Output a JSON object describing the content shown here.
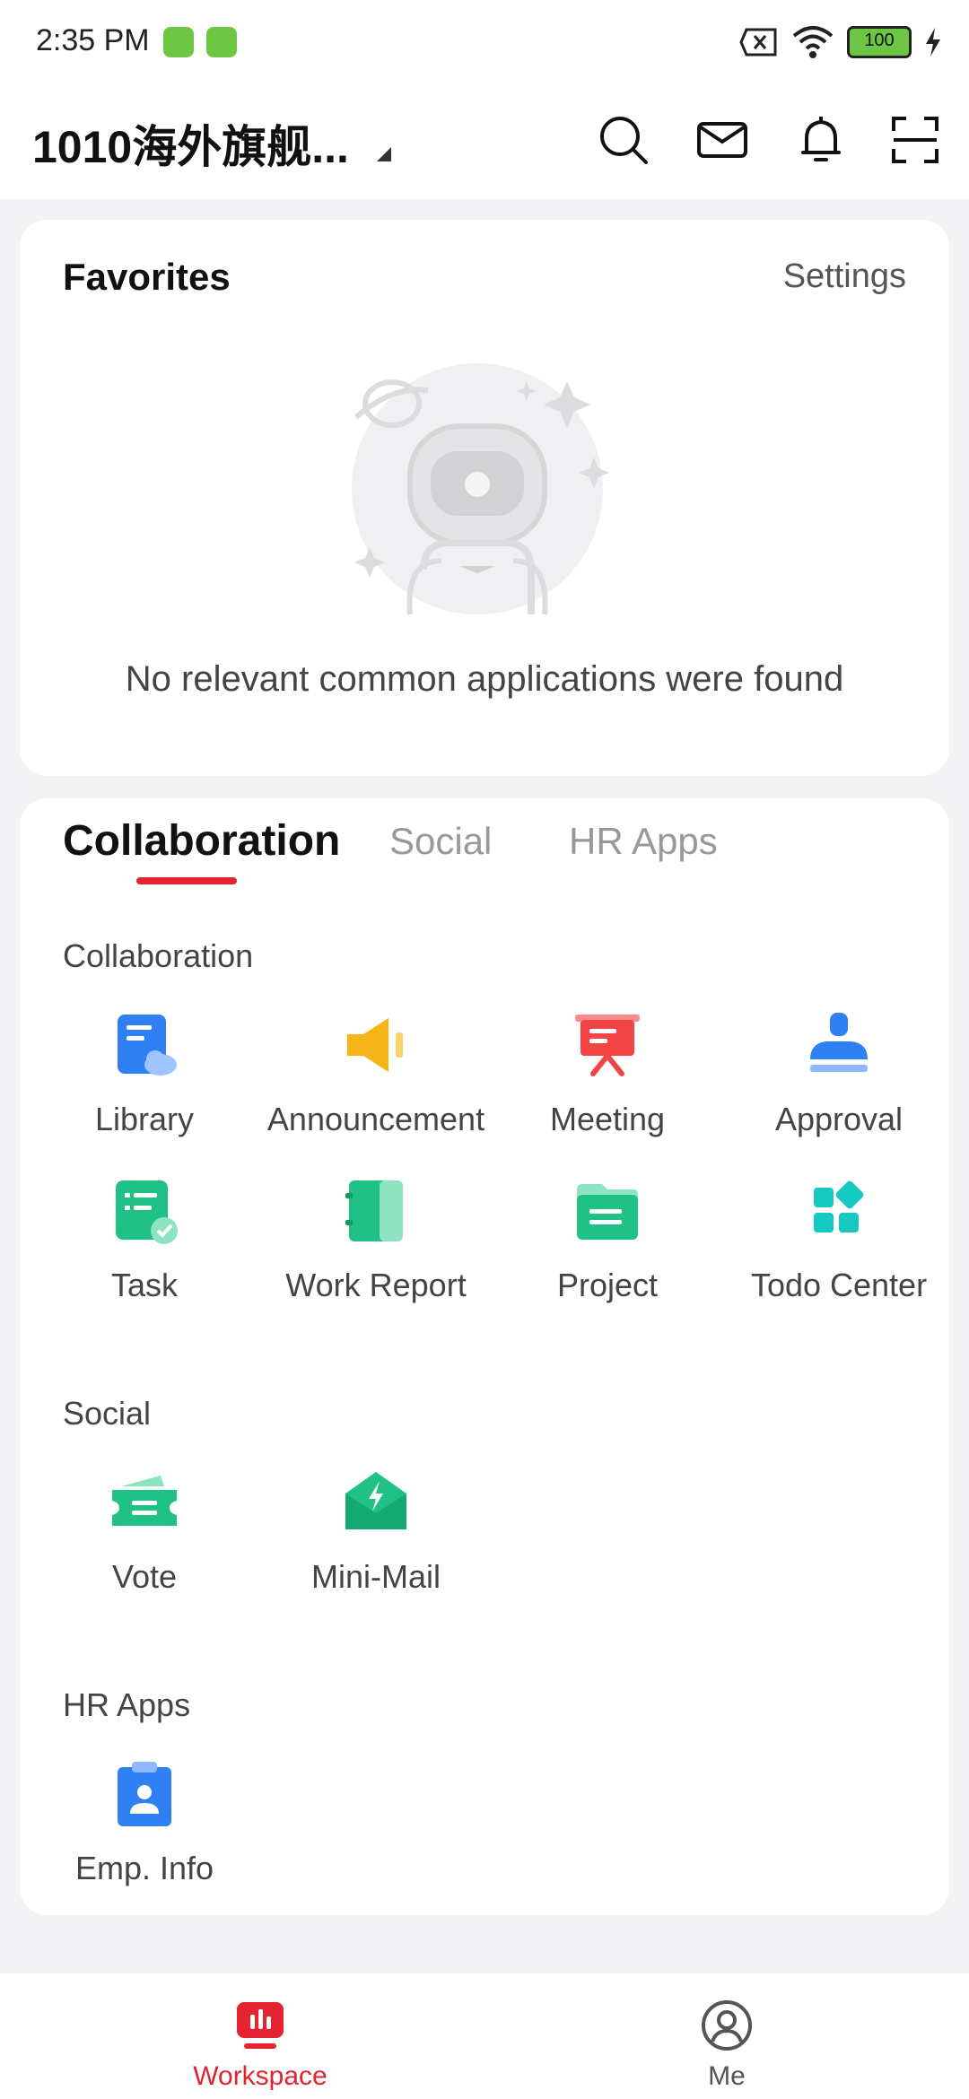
{
  "status": {
    "time": "2:35 PM",
    "battery": "100"
  },
  "header": {
    "org_name": "1010海外旗舰..."
  },
  "favorites": {
    "title": "Favorites",
    "settings_label": "Settings",
    "empty_message": "No relevant common applications were found"
  },
  "tabs": [
    {
      "label": "Collaboration",
      "active": true
    },
    {
      "label": "Social",
      "active": false
    },
    {
      "label": "HR Apps",
      "active": false
    }
  ],
  "sections": {
    "collaboration": {
      "title": "Collaboration",
      "apps": [
        {
          "label": "Library",
          "icon": "library-icon"
        },
        {
          "label": "Announcement",
          "icon": "announcement-icon"
        },
        {
          "label": "Meeting",
          "icon": "meeting-icon"
        },
        {
          "label": "Approval",
          "icon": "approval-icon"
        },
        {
          "label": "Task",
          "icon": "task-icon"
        },
        {
          "label": "Work Report",
          "icon": "work-report-icon"
        },
        {
          "label": "Project",
          "icon": "project-icon"
        },
        {
          "label": "Todo Center",
          "icon": "todo-center-icon"
        }
      ]
    },
    "social": {
      "title": "Social",
      "apps": [
        {
          "label": "Vote",
          "icon": "vote-icon"
        },
        {
          "label": "Mini-Mail",
          "icon": "mini-mail-icon"
        }
      ]
    },
    "hr": {
      "title": "HR Apps",
      "apps": [
        {
          "label": "Emp. Info",
          "icon": "emp-info-icon"
        }
      ]
    }
  },
  "bottom_nav": [
    {
      "label": "Workspace",
      "active": true
    },
    {
      "label": "Me",
      "active": false
    }
  ],
  "colors": {
    "accent": "#e3232f",
    "blue": "#2f7ff5",
    "green": "#1fc187",
    "orange": "#f7b416",
    "red": "#f24444",
    "teal": "#16c9c0"
  }
}
